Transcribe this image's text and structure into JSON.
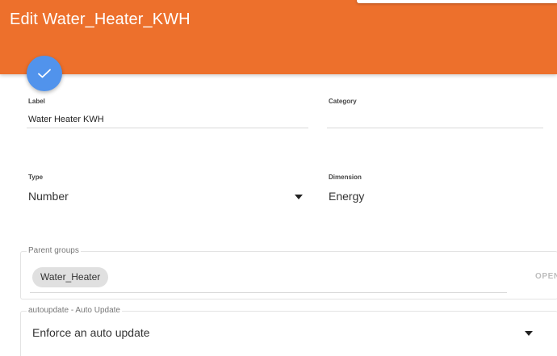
{
  "colors": {
    "header_bg": "#ed702c",
    "fab_bg": "#5193ec",
    "chip_bg": "#e0e0e0"
  },
  "header": {
    "title": "Edit Water_Heater_KWH"
  },
  "fab": {
    "icon": "checkmark-icon"
  },
  "form": {
    "label": {
      "caption": "Label",
      "value": "Water Heater KWH"
    },
    "category": {
      "caption": "Category",
      "value": ""
    },
    "type": {
      "caption": "Type",
      "value": "Number",
      "icon": "dropdown-arrow-icon"
    },
    "dimension": {
      "caption": "Dimension",
      "value": "Energy"
    },
    "parent_groups": {
      "caption": "Parent groups",
      "chips": [
        "Water_Heater"
      ],
      "open_label": "OPEN"
    },
    "autoupdate": {
      "caption": "autoupdate - Auto Update",
      "value": "Enforce an auto update",
      "icon": "dropdown-arrow-icon"
    }
  }
}
